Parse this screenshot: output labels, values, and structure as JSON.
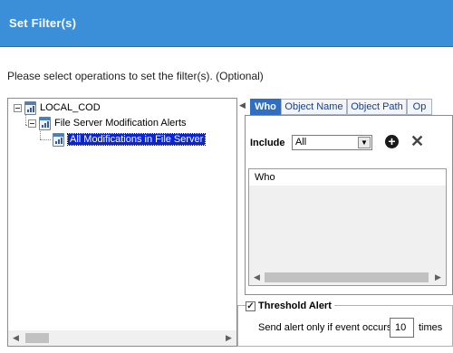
{
  "dialog": {
    "title": "Set Filter(s)",
    "instruction": "Please select operations to set the filter(s). (Optional)"
  },
  "tree": {
    "nodes": [
      {
        "label": "LOCAL_COD",
        "level": 0,
        "expanded": true,
        "selected": false
      },
      {
        "label": "File Server Modification Alerts",
        "level": 1,
        "expanded": true,
        "selected": false
      },
      {
        "label": "All Modifications in File Server",
        "level": 2,
        "expanded": false,
        "selected": true
      }
    ],
    "icon": "report-icon"
  },
  "tabs": {
    "items": [
      {
        "label": "Who",
        "active": true
      },
      {
        "label": "Object Name",
        "active": false
      },
      {
        "label": "Object Path",
        "active": false
      },
      {
        "label": "Op",
        "active": false
      }
    ]
  },
  "filter": {
    "include_label": "Include",
    "include_value": "All",
    "criteria_header": "Who"
  },
  "threshold": {
    "label": "Threshold Alert",
    "checked": true,
    "send_prefix": "Send alert only if event occurs",
    "count": "10",
    "suffix": "times"
  },
  "colors": {
    "title_bar": "#3a8fd8",
    "selection": "#0a24d8",
    "active_tab": "#2f6ec0"
  }
}
